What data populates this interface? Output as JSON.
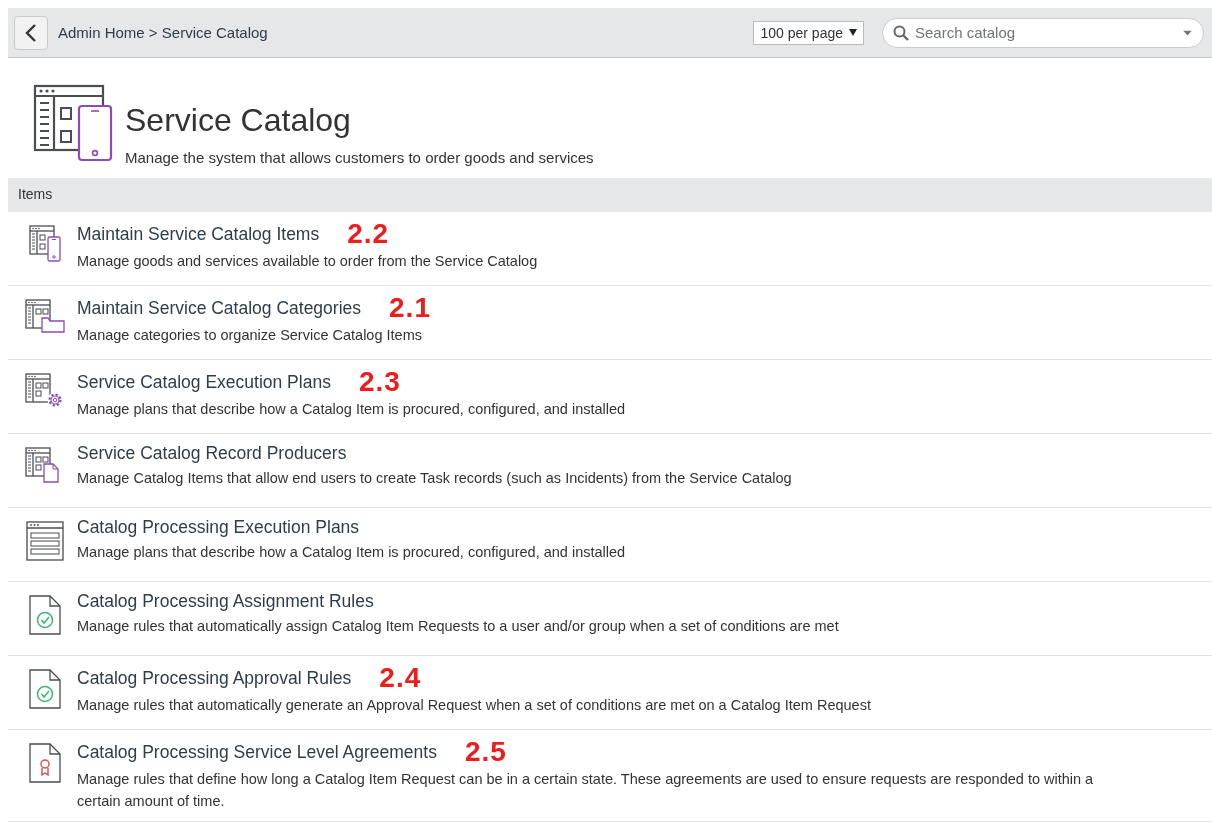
{
  "breadcrumb": "Admin Home > Service Catalog",
  "per_page": {
    "value": "100 per page"
  },
  "search": {
    "placeholder": "Search catalog"
  },
  "header": {
    "title": "Service Catalog",
    "description": "Manage the system that allows customers to order goods and services"
  },
  "section": {
    "title": "Items"
  },
  "items": [
    {
      "kind": "catalog-phone",
      "title": "Maintain Service Catalog Items",
      "description": "Manage goods and services available to order from the Service Catalog",
      "annotation": "2.2"
    },
    {
      "kind": "catalog-folder",
      "title": "Maintain Service Catalog Categories",
      "description": "Manage categories to organize Service Catalog Items",
      "annotation": "2.1"
    },
    {
      "kind": "catalog-gear",
      "title": "Service Catalog Execution Plans",
      "description": "Manage plans that describe how a Catalog Item is procured, configured, and installed",
      "annotation": "2.3"
    },
    {
      "kind": "catalog-document",
      "title": "Service Catalog Record Producers",
      "description": "Manage Catalog Items that allow end users to create Task records (such as Incidents) from the Service Catalog"
    },
    {
      "kind": "list-window",
      "title": "Catalog Processing Execution Plans",
      "description": "Manage plans that describe how a Catalog Item is procured, configured, and installed"
    },
    {
      "kind": "document-check",
      "title": "Catalog Processing Assignment Rules",
      "description": "Manage rules that automatically assign Catalog Item Requests to a user and/or group when a set of conditions are met"
    },
    {
      "kind": "document-check",
      "title": "Catalog Processing Approval Rules",
      "description": "Manage rules that automatically generate an Approval Request when a set of conditions are met on a Catalog Item Request",
      "annotation": "2.4"
    },
    {
      "kind": "document-ribbon",
      "title": "Catalog Processing Service Level Agreements",
      "description": "Manage rules that define how long a Catalog Item Request can be in a certain state. These agreements are used to ensure requests are responded to within a certain amount of time.",
      "annotation": "2.5"
    }
  ]
}
